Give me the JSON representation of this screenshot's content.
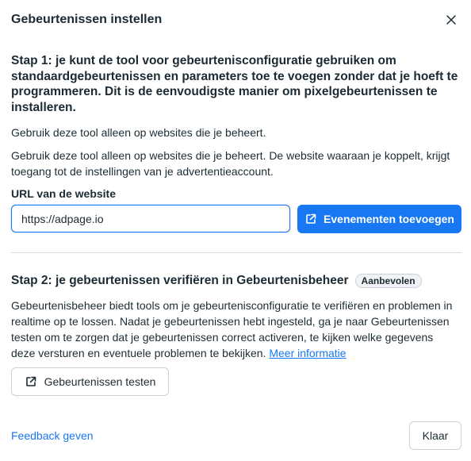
{
  "dialog": {
    "title": "Gebeurtenissen instellen"
  },
  "step1": {
    "heading": "Stap 1: je kunt de tool voor gebeurtenisconfiguratie gebruiken om standaardgebeurtenissen en parameters toe te voegen zonder dat je hoeft te programmeren. Dit is de eenvoudigste manier om pixelgebeurtenissen te installeren.",
    "note": "Gebruik deze tool alleen op websites die je beheert.",
    "description": "Gebruik deze tool alleen op websites die je beheert. De website waaraan je koppelt, krijgt toegang tot de instellingen van je advertentieaccount.",
    "url_label": "URL van de website",
    "url_value": "https://adpage.io",
    "add_events_label": "Evenementen toevoegen"
  },
  "step2": {
    "heading": "Stap 2: je gebeurtenissen verifiëren in Gebeurtenisbeheer",
    "badge": "Aanbevolen",
    "description": "Gebeurtenisbeheer biedt tools om je gebeurtenisconfiguratie te verifiëren en problemen in realtime op te lossen. Nadat je gebeurtenissen hebt ingesteld, ga je naar Gebeurtenissen testen om te zorgen dat je gebeurtenissen correct activeren, te kijken welke gegevens deze versturen en eventuele problemen te bekijken.",
    "more_info_link": "Meer informatie",
    "test_events_label": "Gebeurtenissen testen"
  },
  "footer": {
    "feedback_link": "Feedback geven",
    "done_label": "Klaar"
  },
  "colors": {
    "primary": "#1877f2",
    "text": "#1c2b33",
    "divider": "#dadde1"
  },
  "icons": {
    "close": "close-icon",
    "external": "external-link-icon"
  }
}
